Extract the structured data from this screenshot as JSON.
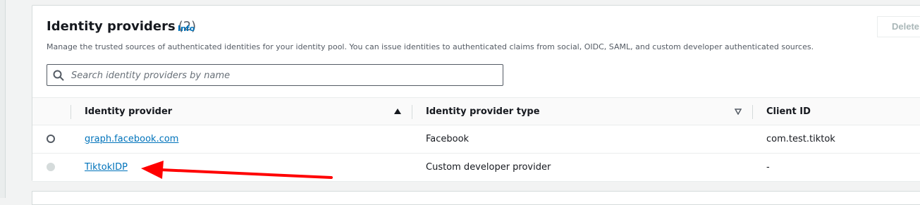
{
  "section": {
    "title": "Identity providers",
    "count": "(2)",
    "info_label": "Info",
    "description": "Manage the trusted sources of authenticated identities for your identity pool. You can issue identities to authenticated claims from social, OIDC, SAML, and custom developer authenticated sources.",
    "delete_label": "Delete"
  },
  "search": {
    "placeholder": "Search identity providers by name",
    "value": ""
  },
  "table": {
    "columns": [
      "Identity provider",
      "Identity provider type",
      "Client ID"
    ],
    "rows": [
      {
        "provider": "graph.facebook.com",
        "type": "Facebook",
        "client_id": "com.test.tiktok",
        "selectable": true
      },
      {
        "provider": "TiktokIDP",
        "type": "Custom developer provider",
        "client_id": "-",
        "selectable": false
      }
    ]
  },
  "colors": {
    "link": "#0073bb",
    "annotation_arrow": "#ff0000"
  },
  "icons": [
    "search-icon",
    "sort-ascending-icon",
    "sort-descending-icon",
    "radio-icon"
  ]
}
